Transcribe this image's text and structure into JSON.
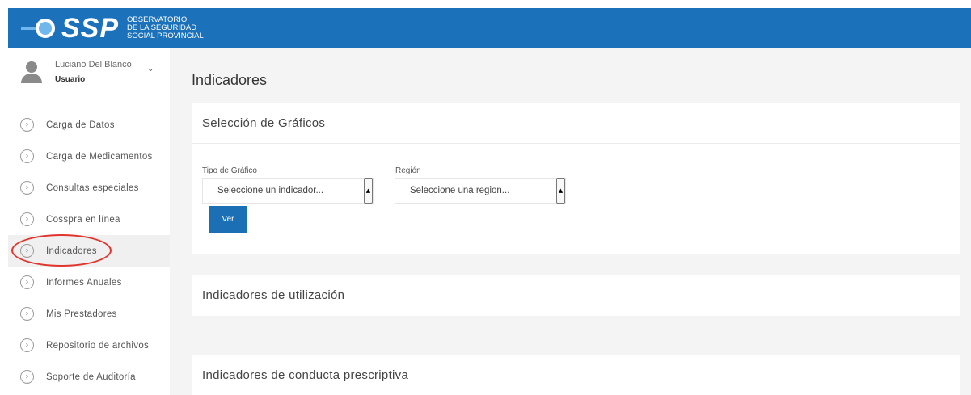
{
  "header": {
    "logo_text": "SSP",
    "logo_sub_line1": "OBSERVATORIO",
    "logo_sub_line2": "DE LA SEGURIDAD",
    "logo_sub_line3": "SOCIAL PROVINCIAL",
    "bg_color": "#1b72bb"
  },
  "user": {
    "name": "Luciano Del Blanco",
    "role": "Usuario"
  },
  "sidebar": {
    "items": [
      {
        "label": "Carga de Datos",
        "icon": "chevron-right-circle-icon"
      },
      {
        "label": "Carga de Medicamentos",
        "icon": "chevron-right-circle-icon"
      },
      {
        "label": "Consultas especiales",
        "icon": "chevron-right-circle-icon"
      },
      {
        "label": "Cosspra en línea",
        "icon": "chevron-right-circle-icon"
      },
      {
        "label": "Indicadores",
        "icon": "chevron-right-circle-icon",
        "active": true
      },
      {
        "label": "Informes Anuales",
        "icon": "chevron-right-circle-icon"
      },
      {
        "label": "Mis Prestadores",
        "icon": "chevron-right-circle-icon"
      },
      {
        "label": "Repositorio de archivos",
        "icon": "chevron-right-circle-icon"
      },
      {
        "label": "Soporte de Auditoría",
        "icon": "chevron-right-circle-icon"
      }
    ],
    "highlight_color": "#e0352d"
  },
  "main": {
    "page_title": "Indicadores",
    "selection_card": {
      "title": "Selección de Gráficos",
      "tipo_label": "Tipo de Gráfico",
      "tipo_value": "Seleccione un indicador...",
      "region_label": "Región",
      "region_value": "Seleccione una region...",
      "ver_label": "Ver"
    },
    "utilizacion_title": "Indicadores de utilización",
    "conducta_title": "Indicadores de conducta prescriptiva"
  }
}
